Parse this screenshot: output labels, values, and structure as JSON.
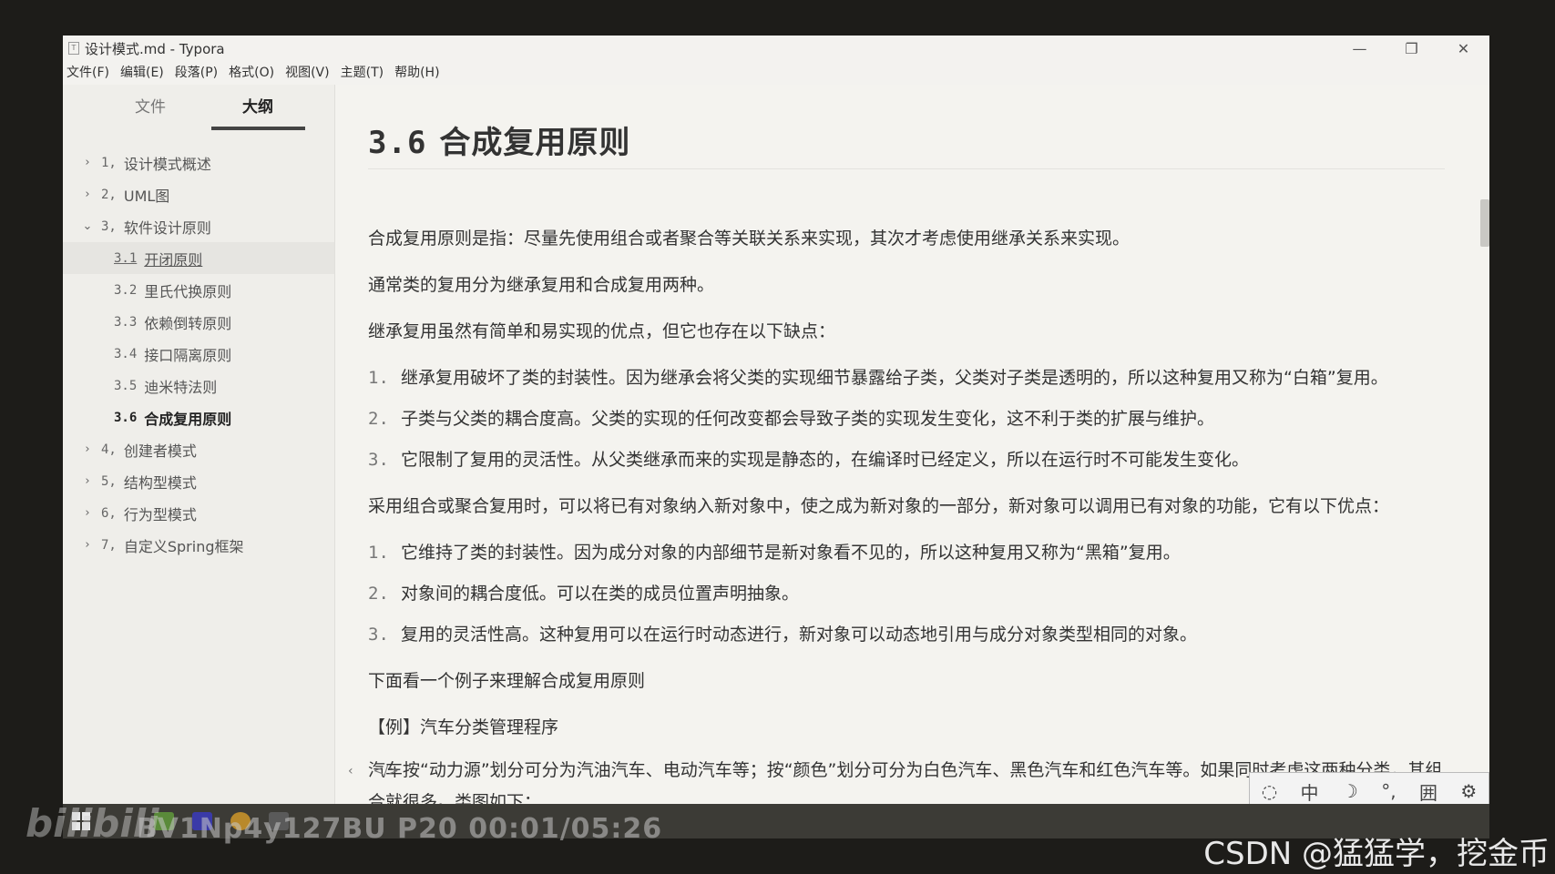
{
  "window": {
    "title": "设计模式.md - Typora",
    "app_icon": "T",
    "controls": {
      "minimize": "—",
      "restore": "❐",
      "close": "✕"
    }
  },
  "menu": [
    "文件(F)",
    "编辑(E)",
    "段落(P)",
    "格式(O)",
    "视图(V)",
    "主题(T)",
    "帮助(H)"
  ],
  "sidebar": {
    "tabs": {
      "files": "文件",
      "outline": "大纲"
    },
    "outline": [
      {
        "caret": "›",
        "num": "1,",
        "label": "设计模式概述"
      },
      {
        "caret": "›",
        "num": "2,",
        "label": "UML图"
      },
      {
        "caret": "⌄",
        "num": "3,",
        "label": "软件设计原则"
      },
      {
        "num": "3.1",
        "label": "开闭原则"
      },
      {
        "num": "3.2",
        "label": "里氏代换原则"
      },
      {
        "num": "3.3",
        "label": "依赖倒转原则"
      },
      {
        "num": "3.4",
        "label": "接口隔离原则"
      },
      {
        "num": "3.5",
        "label": "迪米特法则"
      },
      {
        "num": "3.6",
        "label": "合成复用原则"
      },
      {
        "caret": "›",
        "num": "4,",
        "label": "创建者模式"
      },
      {
        "caret": "›",
        "num": "5,",
        "label": "结构型模式"
      },
      {
        "caret": "›",
        "num": "6,",
        "label": "行为型模式"
      },
      {
        "caret": "›",
        "num": "7,",
        "label": "自定义Spring框架"
      }
    ]
  },
  "doc": {
    "heading_num": "3.6",
    "heading_text": "合成复用原则",
    "p1": "合成复用原则是指：尽量先使用组合或者聚合等关联关系来实现，其次才考虑使用继承关系来实现。",
    "p2": "通常类的复用分为继承复用和合成复用两种。",
    "p3": "继承复用虽然有简单和易实现的优点，但它也存在以下缺点：",
    "list1": [
      {
        "num": "1.",
        "text": "继承复用破坏了类的封装性。因为继承会将父类的实现细节暴露给子类，父类对子类是透明的，所以这种复用又称为“白箱”复用。"
      },
      {
        "num": "2.",
        "text": "子类与父类的耦合度高。父类的实现的任何改变都会导致子类的实现发生变化，这不利于类的扩展与维护。"
      },
      {
        "num": "3.",
        "text": "它限制了复用的灵活性。从父类继承而来的实现是静态的，在编译时已经定义，所以在运行时不可能发生变化。"
      }
    ],
    "p4": "采用组合或聚合复用时，可以将已有对象纳入新对象中，使之成为新对象的一部分，新对象可以调用已有对象的功能，它有以下优点：",
    "list2": [
      {
        "num": "1.",
        "text": "它维持了类的封装性。因为成分对象的内部细节是新对象看不见的，所以这种复用又称为“黑箱”复用。"
      },
      {
        "num": "2.",
        "text": "对象间的耦合度低。可以在类的成员位置声明抽象。"
      },
      {
        "num": "3.",
        "text": "复用的灵活性高。这种复用可以在运行时动态进行，新对象可以动态地引用与成分对象类型相同的对象。"
      }
    ],
    "p5": "下面看一个例子来理解合成复用原则",
    "p6": "【例】汽车分类管理程序",
    "p7": "汽车按“动力源”划分可分为汽油汽车、电动汽车等；按“颜色”划分可分为白色汽车、黑色汽车和红色汽车等。如果同时考虑这两种分类，其组合就很多。类图如下：",
    "footer_left": "‹",
    "footer_code": "</>"
  },
  "overlay": {
    "bili_logo": "bilibili",
    "video_info": "BV1Np4y127BU P20 00:01/05:26",
    "csdn": "CSDN @猛猛学，挖金币"
  },
  "ime": [
    "◌",
    "中",
    "☽",
    "°,",
    "囲",
    "⚙"
  ]
}
